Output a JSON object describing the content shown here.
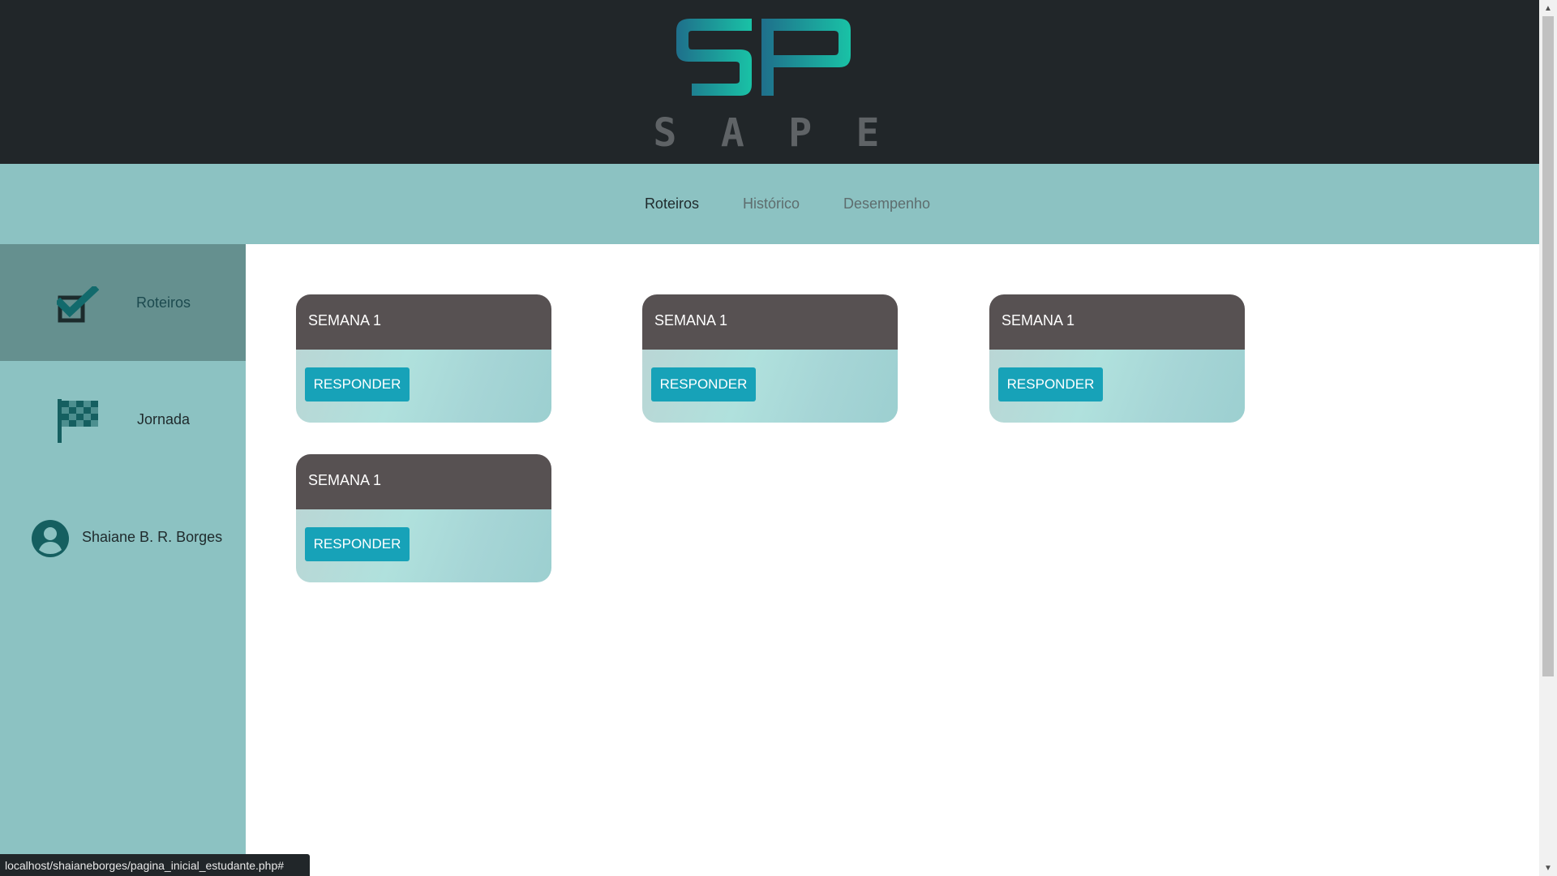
{
  "header": {
    "logo": {
      "monogram": "SP",
      "letters": [
        "S",
        "A",
        "P",
        "E"
      ]
    }
  },
  "topnav": {
    "items": [
      {
        "label": "Roteiros",
        "active": true
      },
      {
        "label": "Histórico",
        "active": false
      },
      {
        "label": "Desempenho",
        "active": false
      }
    ]
  },
  "sidebar": {
    "items": [
      {
        "label": "Roteiros",
        "icon": "checkbox-checked-icon",
        "active": true
      },
      {
        "label": "Jornada",
        "icon": "checkered-flag-icon",
        "active": false
      }
    ],
    "user": {
      "name": "Shaiane B. R. Borges",
      "icon": "user-avatar-icon"
    }
  },
  "cards": [
    {
      "title": "SEMANA 1",
      "button": "RESPONDER"
    },
    {
      "title": "SEMANA 1",
      "button": "RESPONDER"
    },
    {
      "title": "SEMANA 1",
      "button": "RESPONDER"
    },
    {
      "title": "SEMANA 1",
      "button": "RESPONDER"
    }
  ],
  "statusbar": {
    "url": "localhost/shaianeborges/pagina_inicial_estudante.php#"
  },
  "colors": {
    "header_bg": "#212629",
    "nav_bg": "#8cc2c2",
    "sidebar_active_bg": "#65908f",
    "card_head_bg": "#575152",
    "button_bg": "#17a2b8",
    "logo_gradient_start": "#1f6f8b",
    "logo_gradient_end": "#19c2a6"
  }
}
